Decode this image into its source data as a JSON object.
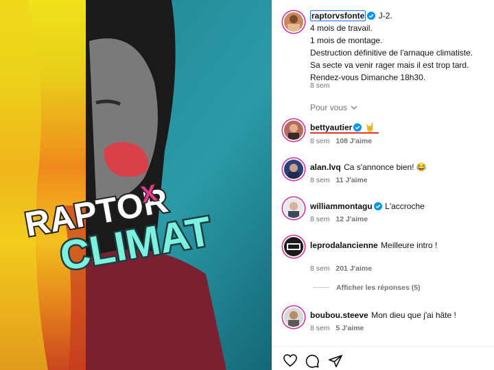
{
  "media": {
    "title_line1": "RAPTOR",
    "title_x": "X",
    "title_line2": "CLIMAT"
  },
  "post": {
    "username": "raptorvsfonte",
    "caption_lines": [
      "J-2.",
      "4 mois de travail.",
      "1 mois de montage.",
      "Destruction définitive de l'arnaque climatiste.",
      "Sa secte va venir rager mais il est trop tard.",
      "Rendez-vous Dimanche 18h30."
    ],
    "time": "8 sem",
    "for_you": "Pour vous"
  },
  "comments": [
    {
      "username": "bettyautier",
      "verified": true,
      "text": "🤘",
      "time": "8 sem",
      "likes": "108 J'aime"
    },
    {
      "username": "alan.lvq",
      "verified": false,
      "text": "Ca s'annonce bien! 😂",
      "time": "8 sem",
      "likes": "11 J'aime"
    },
    {
      "username": "williammontagu",
      "verified": true,
      "text": "L'accroche",
      "time": "8 sem",
      "likes": "12 J'aime"
    },
    {
      "username": "leprodalancienne",
      "verified": false,
      "text": "Meilleure intro !",
      "time": "8 sem",
      "likes": "201 J'aime",
      "replies": "Afficher les réponses (5)"
    },
    {
      "username": "boubou.steeve",
      "verified": false,
      "text": "Mon dieu que j'ai hâte !",
      "time": "8 sem",
      "likes": "5 J'aime"
    }
  ],
  "colors": {
    "accent_blue": "#1a73e8",
    "verified_blue": "#0095f6",
    "underline_red": "#e0332b",
    "teal_title": "#7ef0e0"
  }
}
